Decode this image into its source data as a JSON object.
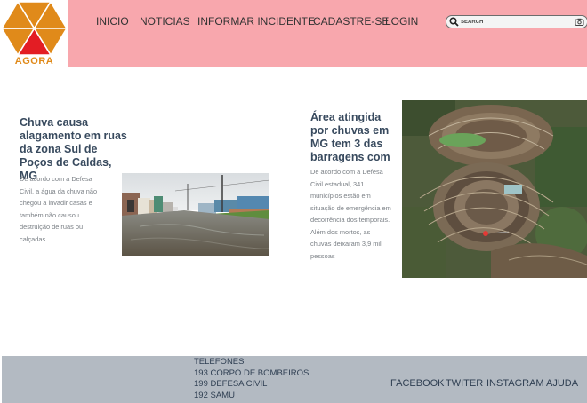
{
  "brand": {
    "logo_text": "AGORA",
    "logo_colors": [
      "#e08a1a",
      "#e31d24"
    ]
  },
  "nav": {
    "items": [
      {
        "label": "INICIO"
      },
      {
        "label": "NOTICIAS"
      },
      {
        "label": "INFORMAR INCIDENTE"
      },
      {
        "label": "CADASTRE-SE"
      },
      {
        "label": "LOGIN"
      }
    ],
    "background": "#f8a7ad"
  },
  "search": {
    "placeholder": "SEARCH",
    "value": "",
    "icon": "search-icon",
    "camera_icon": "camera-icon"
  },
  "news": [
    {
      "title": "Chuva causa alagamento em ruas da zona Sul de Poços de Caldas, MG",
      "body": "De acordo com a Defesa Civil, a água da chuva não chegou a invadir casas e também não causou destruição de ruas ou calçadas."
    },
    {
      "title": "Área atingida por chuvas em MG tem 3 das barragens com",
      "body": "De acordo com a Defesa Civil estadual, 341 municípios estão em situação de emergência em decorrência dos temporais. Além dos mortos, as chuvas deixaram 3,9 mil pessoas"
    }
  ],
  "footer": {
    "phones_title": "TELEFONES",
    "phones": [
      "193 CORPO DE BOMBEIROS",
      "199 DEFESA CIVIL",
      "192 SAMU"
    ],
    "links": [
      {
        "label": "FACEBOOK"
      },
      {
        "label": "TWITER"
      },
      {
        "label": "INSTAGRAM"
      },
      {
        "label": "AJUDA"
      }
    ],
    "background": "#b3bac2"
  }
}
